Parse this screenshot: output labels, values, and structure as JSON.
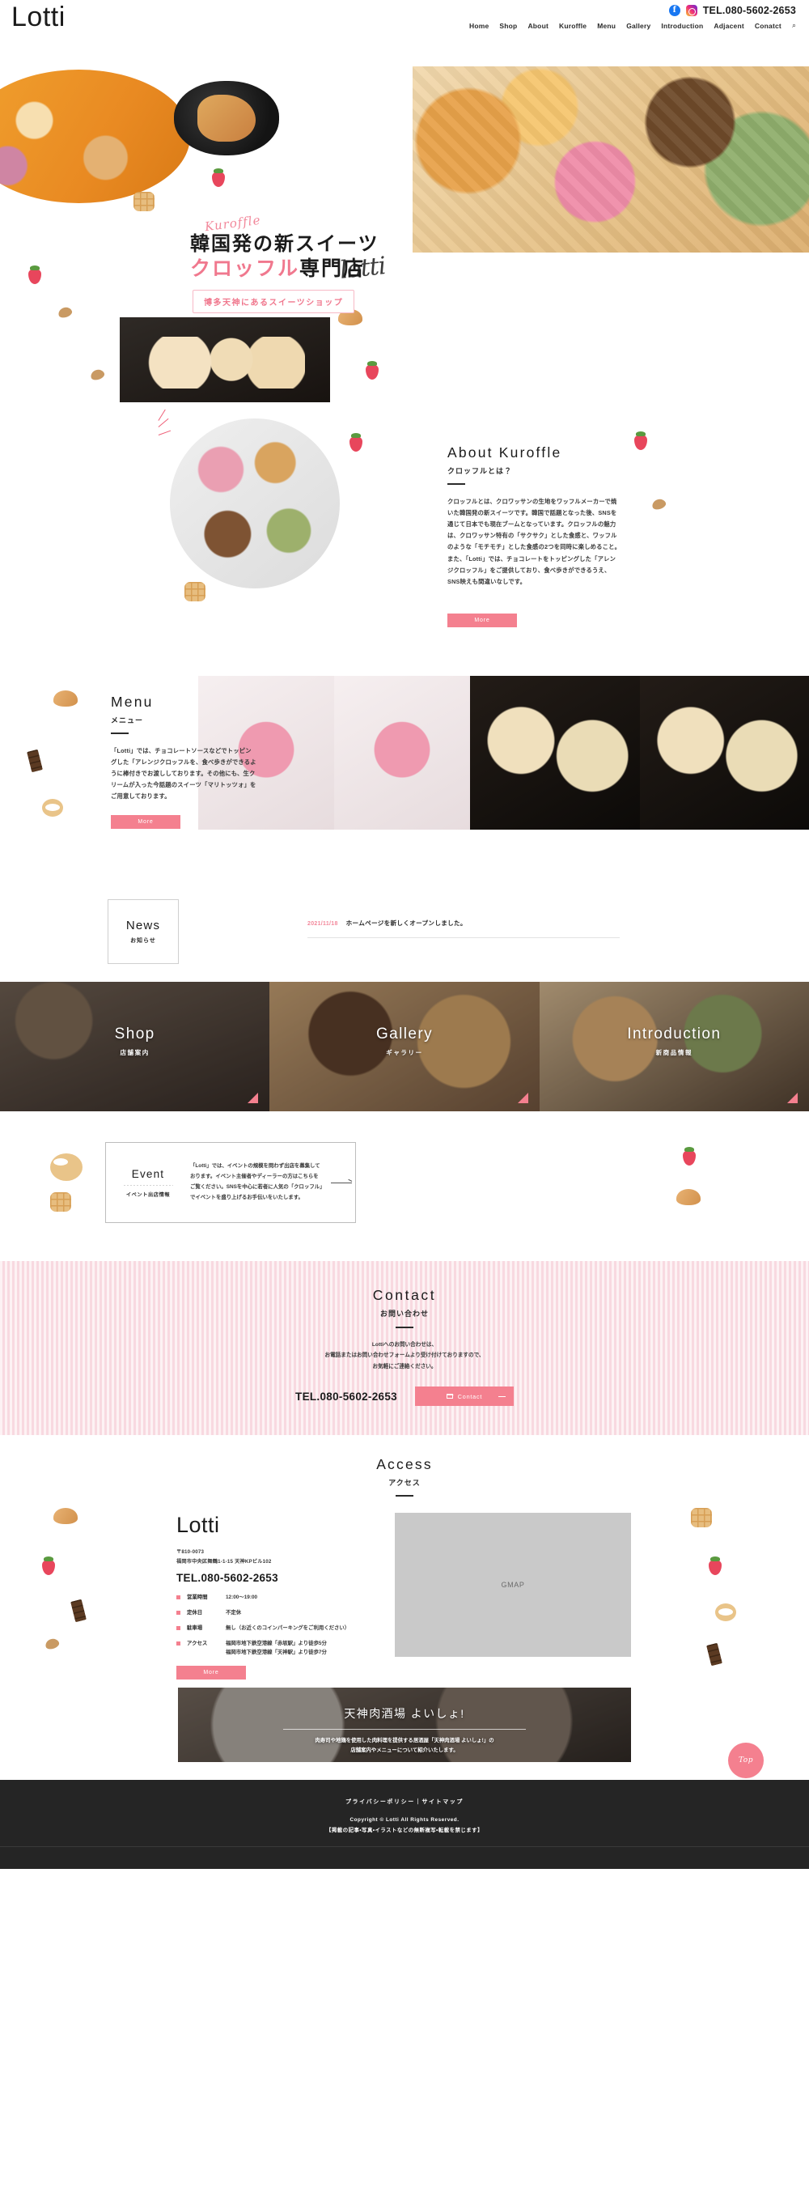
{
  "header": {
    "brand": "Lotti",
    "tel": "TEL.080-5602-2653",
    "social": [
      {
        "name": "facebook-icon",
        "label": "f"
      },
      {
        "name": "instagram-icon",
        "label": ""
      }
    ],
    "nav": [
      {
        "label": "Home"
      },
      {
        "label": "Shop"
      },
      {
        "label": "About"
      },
      {
        "label": "Kuroffle"
      },
      {
        "label": "Menu"
      },
      {
        "label": "Gallery"
      },
      {
        "label": "Introduction"
      },
      {
        "label": "Adjacent"
      },
      {
        "label": "Conatct"
      }
    ],
    "search_icon": "⌕"
  },
  "hero": {
    "script": "Kuroffle",
    "line1": "韓国発の新スイーツ",
    "line2_pink": "クロッフル",
    "line2_black": "専門店",
    "signature": "lotti",
    "badge": "博多天神にあるスイーツショップ"
  },
  "about": {
    "title": "About Kuroffle",
    "subtitle": "クロッフルとは？",
    "body": "クロッフルとは、クロワッサンの生地をワッフルメーカーで焼いた韓国発の新スイーツです。韓国で話題となった後、SNSを通じて日本でも現在ブームとなっています。クロッフルの魅力は、クロワッサン特有の「サクサク」とした食感と、ワッフルのような「モチモチ」とした食感の2つを同時に楽しめること。また、「Lotti」では、チョコレートをトッピングした「アレンジクロッフル」をご提供しており、食べ歩きができるうえ、SNS映えも間違いなしです。",
    "more": "More"
  },
  "menu": {
    "title": "Menu",
    "subtitle": "メニュー",
    "body": "「Lotti」では、チョコレートソースなどでトッピングした「アレンジクロッフルを、食べ歩きができるように棒付きでお渡ししております。その他にも、生クリームが入った今話題のスイーツ「マリトッツォ」をご用意しております。",
    "more": "More"
  },
  "news": {
    "title": "News",
    "subtitle": "お知らせ",
    "items": [
      {
        "date": "2021/11/18",
        "text": "ホームページを新しくオープンしました。"
      }
    ]
  },
  "banners": [
    {
      "title": "Shop",
      "subtitle": "店舗案内"
    },
    {
      "title": "Gallery",
      "subtitle": "ギャラリー"
    },
    {
      "title": "Introduction",
      "subtitle": "新商品情報"
    }
  ],
  "event": {
    "title": "Event",
    "subtitle": "イベント出店情報",
    "body": "「Lotti」では、イベントの規模を問わず出店を募集しております。イベント主催者やディーラーの方はこちらをご覧ください。SNSを中心に若者に人気の「クロッフル」でイベントを盛り上げるお手伝いをいたします。"
  },
  "contact": {
    "title": "Contact",
    "subtitle": "お問い合わせ",
    "body_l1": "Lottiへのお問い合わせは、",
    "body_l2": "お電話またはお問い合わせフォームより受け付けておりますので、",
    "body_l3": "お気軽にご連絡ください。",
    "tel": "TEL.080-5602-2653",
    "button": "Contact"
  },
  "access": {
    "title": "Access",
    "subtitle": "アクセス",
    "logo": "Lotti",
    "zip": "〒810-0073",
    "address": "福岡市中央区舞鶴1-1-15 天神KPビル102",
    "tel": "TEL.080-5602-2653",
    "rows": [
      {
        "key": "営業時間",
        "value": "12:00〜19:00"
      },
      {
        "key": "定休日",
        "value": "不定休"
      },
      {
        "key": "駐車場",
        "value": "無し（お近くのコインパーキングをご利用ください）"
      },
      {
        "key": "アクセス",
        "value": "福岡市地下鉄空港線「赤坂駅」より徒歩5分\n福岡市地下鉄空港線「天神駅」より徒歩7分"
      }
    ],
    "more": "More",
    "map_label": "GMAP"
  },
  "bottom_banner": {
    "title": "天神肉酒場 よいしょ!",
    "text_l1": "肉寿司や地鶏を使用した肉料理を提供する居酒屋「天神肉酒場 よいしょ!」の",
    "text_l2": "店舗案内やメニューについて紹介いたします。"
  },
  "footer": {
    "links": [
      {
        "label": "プライバシーポリシー"
      },
      {
        "label": "サイトマップ"
      }
    ],
    "separator": "｜",
    "copyright": "Copyright © Lotti All Rights Reserved.",
    "note": "【掲載の記事・写真・イラストなどの無断複写・転載を禁じます】",
    "top_button": "Top"
  }
}
